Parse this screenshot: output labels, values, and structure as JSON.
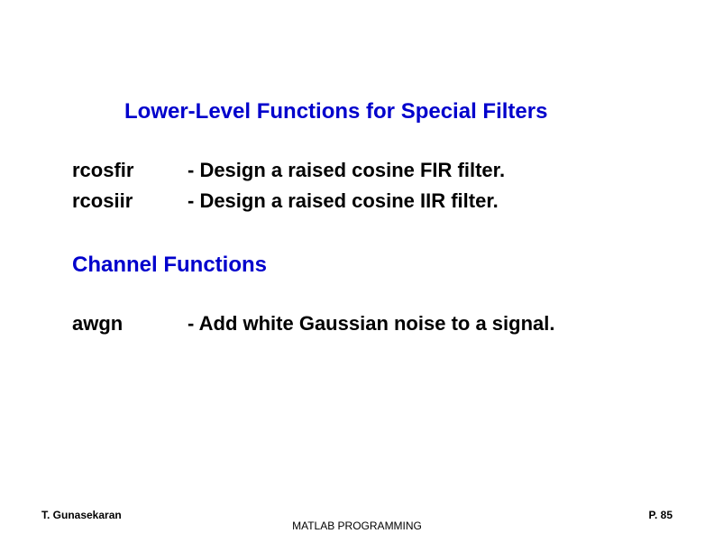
{
  "headings": {
    "lower_level": "Lower-Level Functions for Special Filters",
    "channel": "Channel Functions"
  },
  "functions": {
    "rcosfir": {
      "name": "rcosfir",
      "desc": "- Design a raised cosine FIR filter."
    },
    "rcosiir": {
      "name": "rcosiir",
      "desc": "- Design a raised cosine IIR filter."
    },
    "awgn": {
      "name": "awgn",
      "desc": "- Add white Gaussian noise to a signal."
    }
  },
  "footer": {
    "author": "T. Gunasekaran",
    "course": "MATLAB PROGRAMMING",
    "page": "P. 85"
  }
}
